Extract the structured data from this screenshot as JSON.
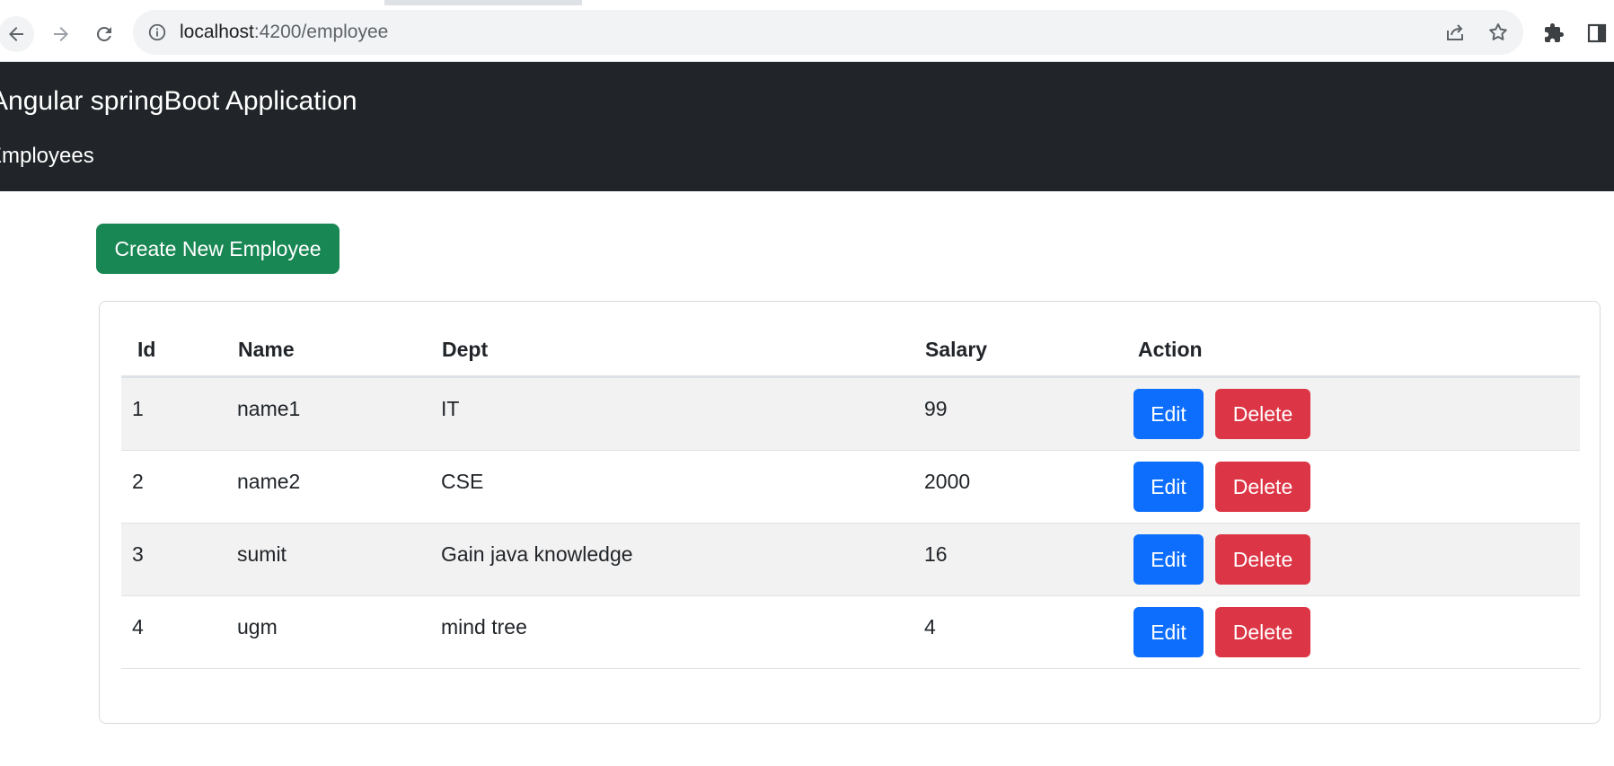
{
  "browser": {
    "url_host": "localhost",
    "url_path": ":4200/employee"
  },
  "navbar": {
    "brand": "Angular springBoot Application",
    "link": "Employees"
  },
  "actions": {
    "create_label": "Create New Employee"
  },
  "table": {
    "headers": [
      "Id",
      "Name",
      "Dept",
      "Salary",
      "Action"
    ],
    "rows": [
      {
        "id": "1",
        "name": "name1",
        "dept": "IT",
        "salary": "99"
      },
      {
        "id": "2",
        "name": "name2",
        "dept": "CSE",
        "salary": "2000"
      },
      {
        "id": "3",
        "name": "sumit",
        "dept": "Gain java knowledge",
        "salary": "16"
      },
      {
        "id": "4",
        "name": "ugm",
        "dept": "mind tree",
        "salary": "4"
      }
    ],
    "edit_label": "Edit",
    "delete_label": "Delete"
  },
  "colors": {
    "navbar_bg": "#212529",
    "create_btn": "#198754",
    "edit_btn": "#0d6efd",
    "delete_btn": "#dc3545",
    "striped_row": "#f2f2f2"
  }
}
